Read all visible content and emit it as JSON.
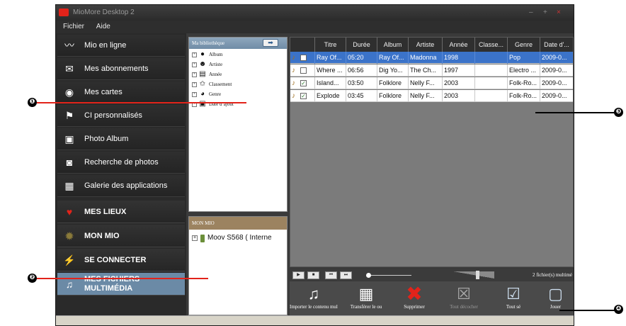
{
  "window": {
    "title": "MioMore Desktop 2",
    "controls": [
      "–",
      "+",
      "×"
    ]
  },
  "menu": [
    "Fichier",
    "Aide"
  ],
  "sidebar": {
    "items": [
      {
        "label": "Mio en ligne",
        "icon": "wave-icon"
      },
      {
        "label": "Mes abonnements",
        "icon": "envelope-icon"
      },
      {
        "label": "Mes cartes",
        "icon": "compass-icon"
      },
      {
        "label": "CI personnalisés",
        "icon": "flag-icon"
      },
      {
        "label": "Photo Album",
        "icon": "photo-album-icon"
      },
      {
        "label": "Recherche de photos",
        "icon": "camera-icon"
      },
      {
        "label": "Galerie des applications",
        "icon": "grid-icon"
      }
    ],
    "categories": [
      {
        "label": "MES LIEUX",
        "icon": "heart-icon",
        "color": "#e2231a"
      },
      {
        "label": "MON MIO",
        "icon": "gear-icon",
        "color": "#8a7a3a"
      },
      {
        "label": "SE CONNECTER",
        "icon": "connect-icon",
        "color": "#6a8a3a"
      },
      {
        "label": "MES FICHIERS MULTIMÉDIA",
        "icon": "music-icon",
        "color": "#ffffff"
      }
    ]
  },
  "library": {
    "header": "Ma bibliothèque",
    "tree": [
      {
        "label": "Album"
      },
      {
        "label": "Artiste"
      },
      {
        "label": "Année"
      },
      {
        "label": "Classement"
      },
      {
        "label": "Genre"
      },
      {
        "label": "Date d’ajout"
      }
    ]
  },
  "mio": {
    "header": "MON MIO",
    "device": "Moov S568 ( Interne"
  },
  "table": {
    "columns": [
      "Titre",
      "Durée",
      "Album",
      "Artiste",
      "Année",
      "Classe...",
      "Genre",
      "Date d'..."
    ],
    "rows": [
      {
        "titre": "Ray Of...",
        "duree": "05:20",
        "album": "Ray Of...",
        "artiste": "Madonna",
        "annee": "1998",
        "classe": "",
        "genre": "Pop",
        "date": "2009-0...",
        "checked": false,
        "selected": true
      },
      {
        "titre": "Where ...",
        "duree": "06:56",
        "album": "Dig Yo...",
        "artiste": "The Ch...",
        "annee": "1997",
        "classe": "",
        "genre": "Electro ...",
        "date": "2009-0...",
        "checked": false,
        "selected": false
      },
      {
        "titre": "Island...",
        "duree": "03:50",
        "album": "Folklore",
        "artiste": "Nelly F...",
        "annee": "2003",
        "classe": "",
        "genre": "Folk-Ro...",
        "date": "2009-0...",
        "checked": true,
        "selected": false
      },
      {
        "titre": "Explode",
        "duree": "03:45",
        "album": "Folklore",
        "artiste": "Nelly F...",
        "annee": "2003",
        "classe": "",
        "genre": "Folk-Ro...",
        "date": "2009-0...",
        "checked": true,
        "selected": false
      }
    ]
  },
  "player": {
    "status": "2 fichier(s) multimé"
  },
  "toolbar": [
    {
      "label": "Importer le contenu multim",
      "icon": "import-music-icon"
    },
    {
      "label": "Transférer le ou",
      "icon": "transfer-icon"
    },
    {
      "label": "Supprimer",
      "icon": "delete-icon"
    },
    {
      "label": "Tout décocher",
      "icon": "uncheck-icon"
    },
    {
      "label": "Tout sé",
      "icon": "check-all-icon"
    },
    {
      "label": "Jouer",
      "icon": "play-icon"
    }
  ],
  "callouts": [
    "❶",
    "❷",
    "❸",
    "❹"
  ]
}
